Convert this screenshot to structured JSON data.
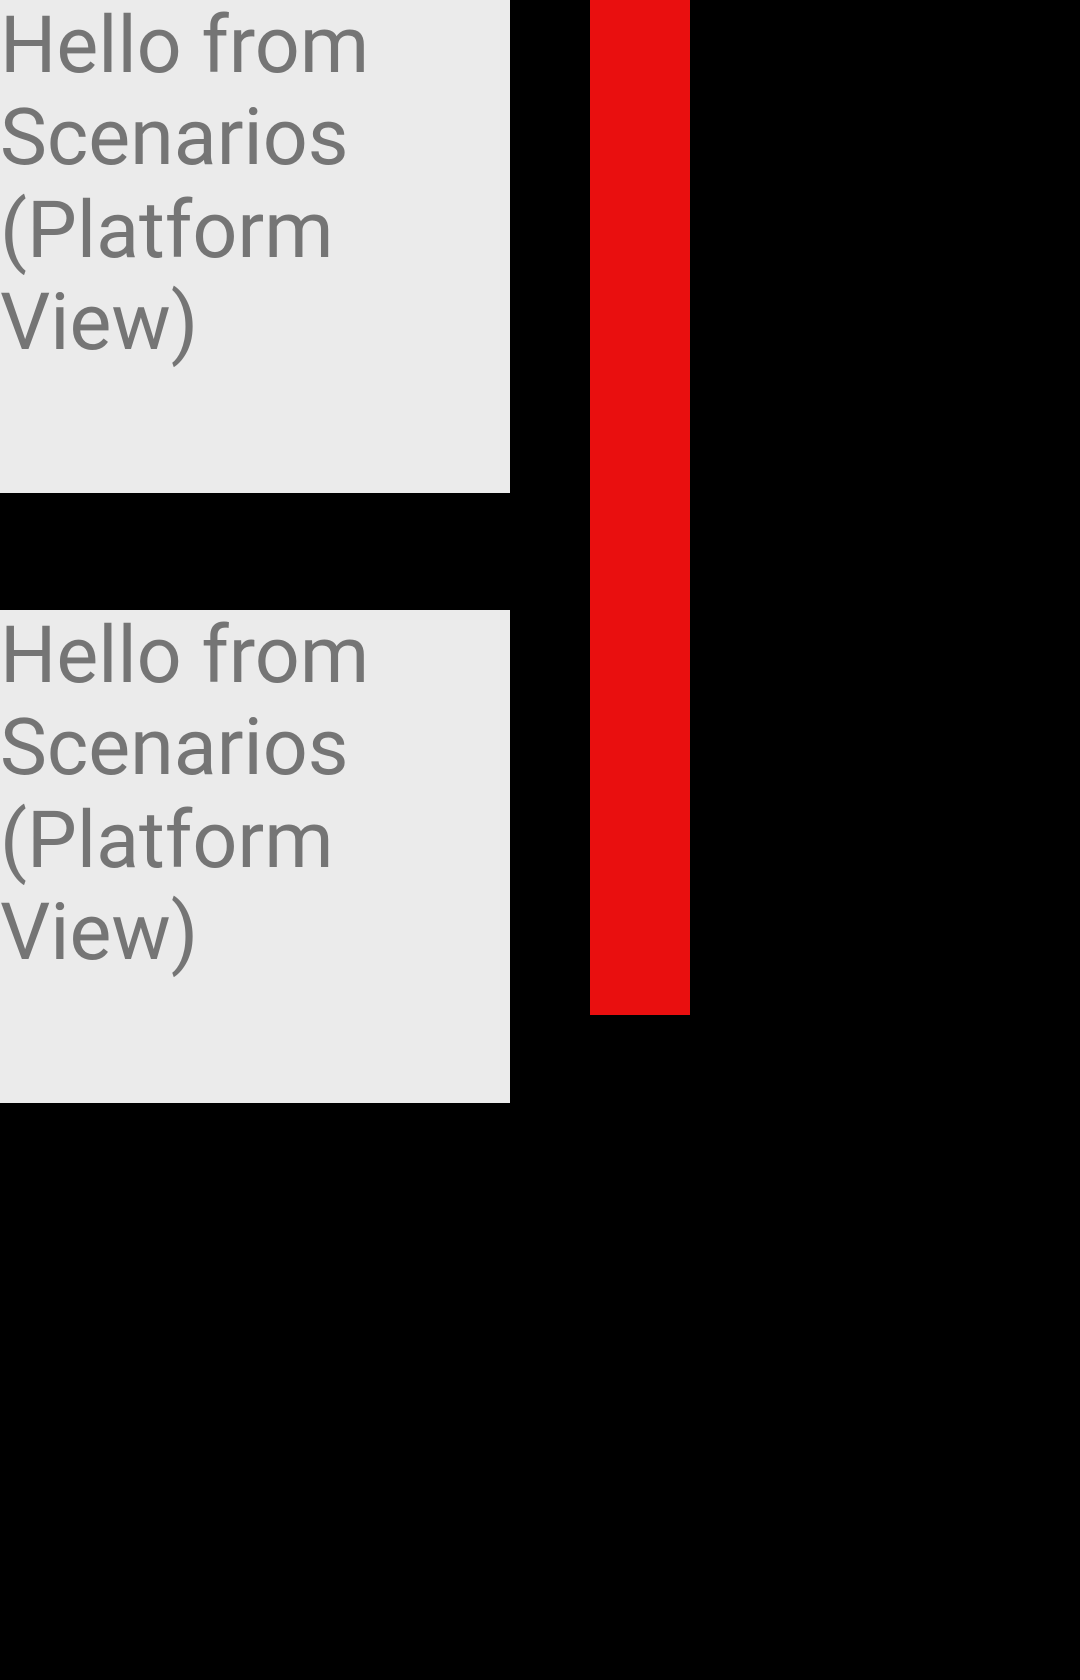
{
  "tiles": [
    {
      "text": "Hello from Scenarios (Platform View)"
    },
    {
      "text": "Hello from Scenarios (Platform View)"
    }
  ],
  "colors": {
    "background": "#000000",
    "tile_background": "#ebebeb",
    "tile_text": "#757575",
    "bar": "#e90f0f"
  }
}
